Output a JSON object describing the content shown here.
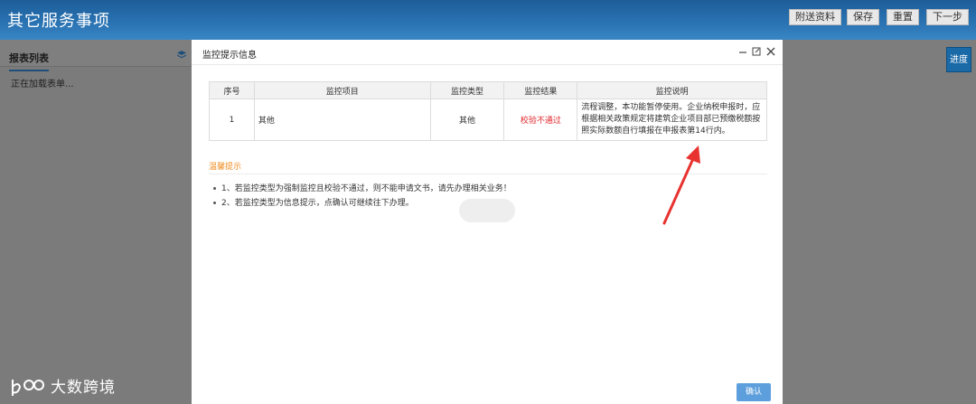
{
  "app": {
    "title": "其它服务事项",
    "buttons": [
      "附送资料",
      "保存",
      "重置",
      "下一步"
    ],
    "progress_label": "进度"
  },
  "left": {
    "tab": "报表列表",
    "loading": "正在加载表单..."
  },
  "modal": {
    "title": "监控提示信息",
    "columns": [
      "序号",
      "监控项目",
      "监控类型",
      "监控结果",
      "监控说明"
    ],
    "rows": [
      {
        "no": "1",
        "item": "其他",
        "type": "其他",
        "result": "校验不通过",
        "desc": "流程调整，本功能暂停使用。企业纳税申报时，应根据相关政策规定将建筑企业项目部已预缴税额按照实际数额自行填报在申报表第14行内。"
      }
    ],
    "tips_title": "温馨提示",
    "tips": [
      "1、若监控类型为强制监控且校验不通过，则不能申请文书，请先办理相关业务！",
      "2、若监控类型为信息提示，点确认可继续往下办理。"
    ],
    "confirm_label": "确认"
  },
  "colors": {
    "fail": "#e0262b",
    "tips": "#f08c1f",
    "arrow": "#e8322f",
    "primary": "#5d9fdc"
  },
  "watermark": {
    "text": "大数跨境"
  }
}
